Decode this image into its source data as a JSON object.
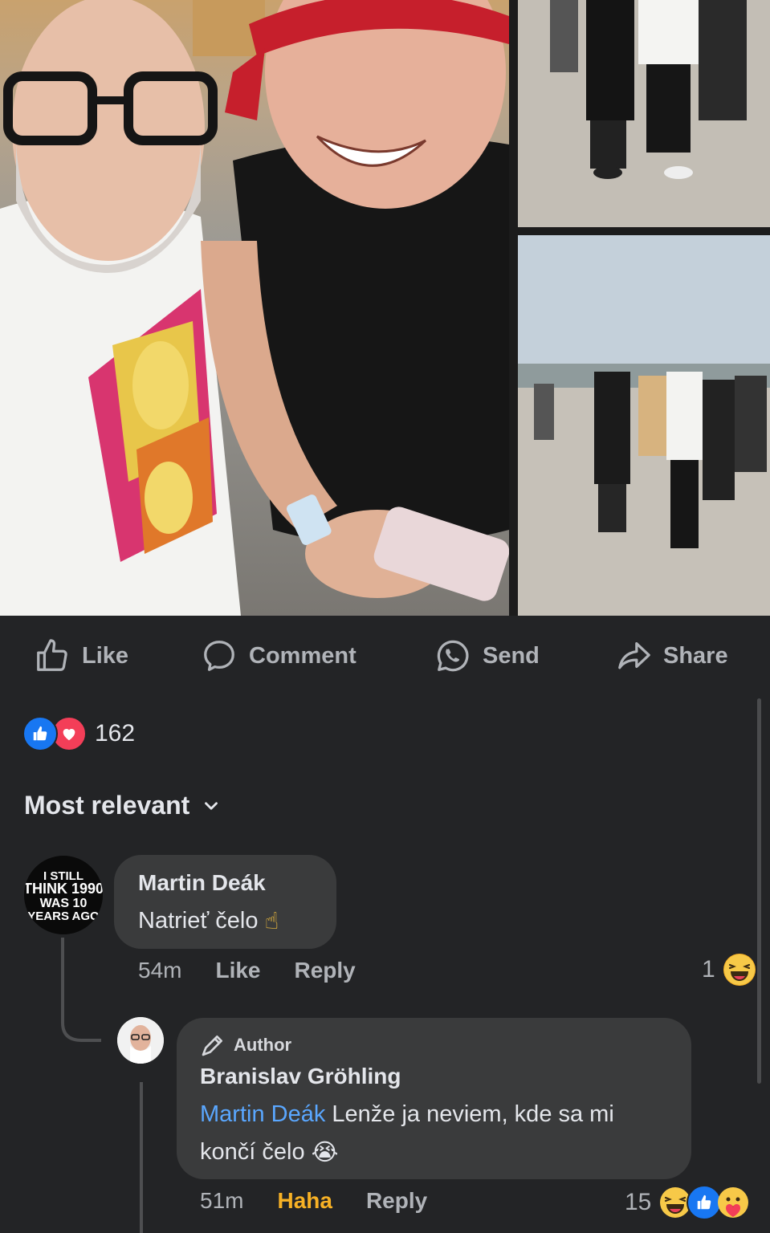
{
  "actions": {
    "like": "Like",
    "comment": "Comment",
    "send": "Send",
    "share": "Share"
  },
  "reactions": {
    "count": "162",
    "icons": [
      "like-icon",
      "love-icon"
    ]
  },
  "sort": {
    "label": "Most relevant"
  },
  "avatar1_text": [
    "I STILL",
    "THINK 1990",
    "WAS 10",
    "YEARS AGO"
  ],
  "comments": [
    {
      "author": "Martin Deák",
      "text": "Natrieť čelo",
      "emoji": "☝",
      "time": "54m",
      "like": "Like",
      "reply": "Reply",
      "reaction_count": "1",
      "reaction_icons": [
        "haha-icon"
      ]
    },
    {
      "badge": "Author",
      "author": "Branislav Gröhling",
      "mention": "Martin Deák",
      "text_line1": " Lenže ja neviem, kde sa mi",
      "text_line2": "končí čelo",
      "emoji": "😭",
      "time": "51m",
      "like": "Haha",
      "reply": "Reply",
      "reaction_count": "15",
      "reaction_icons": [
        "haha-icon",
        "like-icon",
        "care-icon"
      ]
    }
  ],
  "colors": {
    "background": "#232426",
    "bubble": "#3a3b3c",
    "mention": "#5aa7ff",
    "haha": "#f7b125",
    "like_blue": "#1877f2",
    "love_red": "#f33e58"
  }
}
